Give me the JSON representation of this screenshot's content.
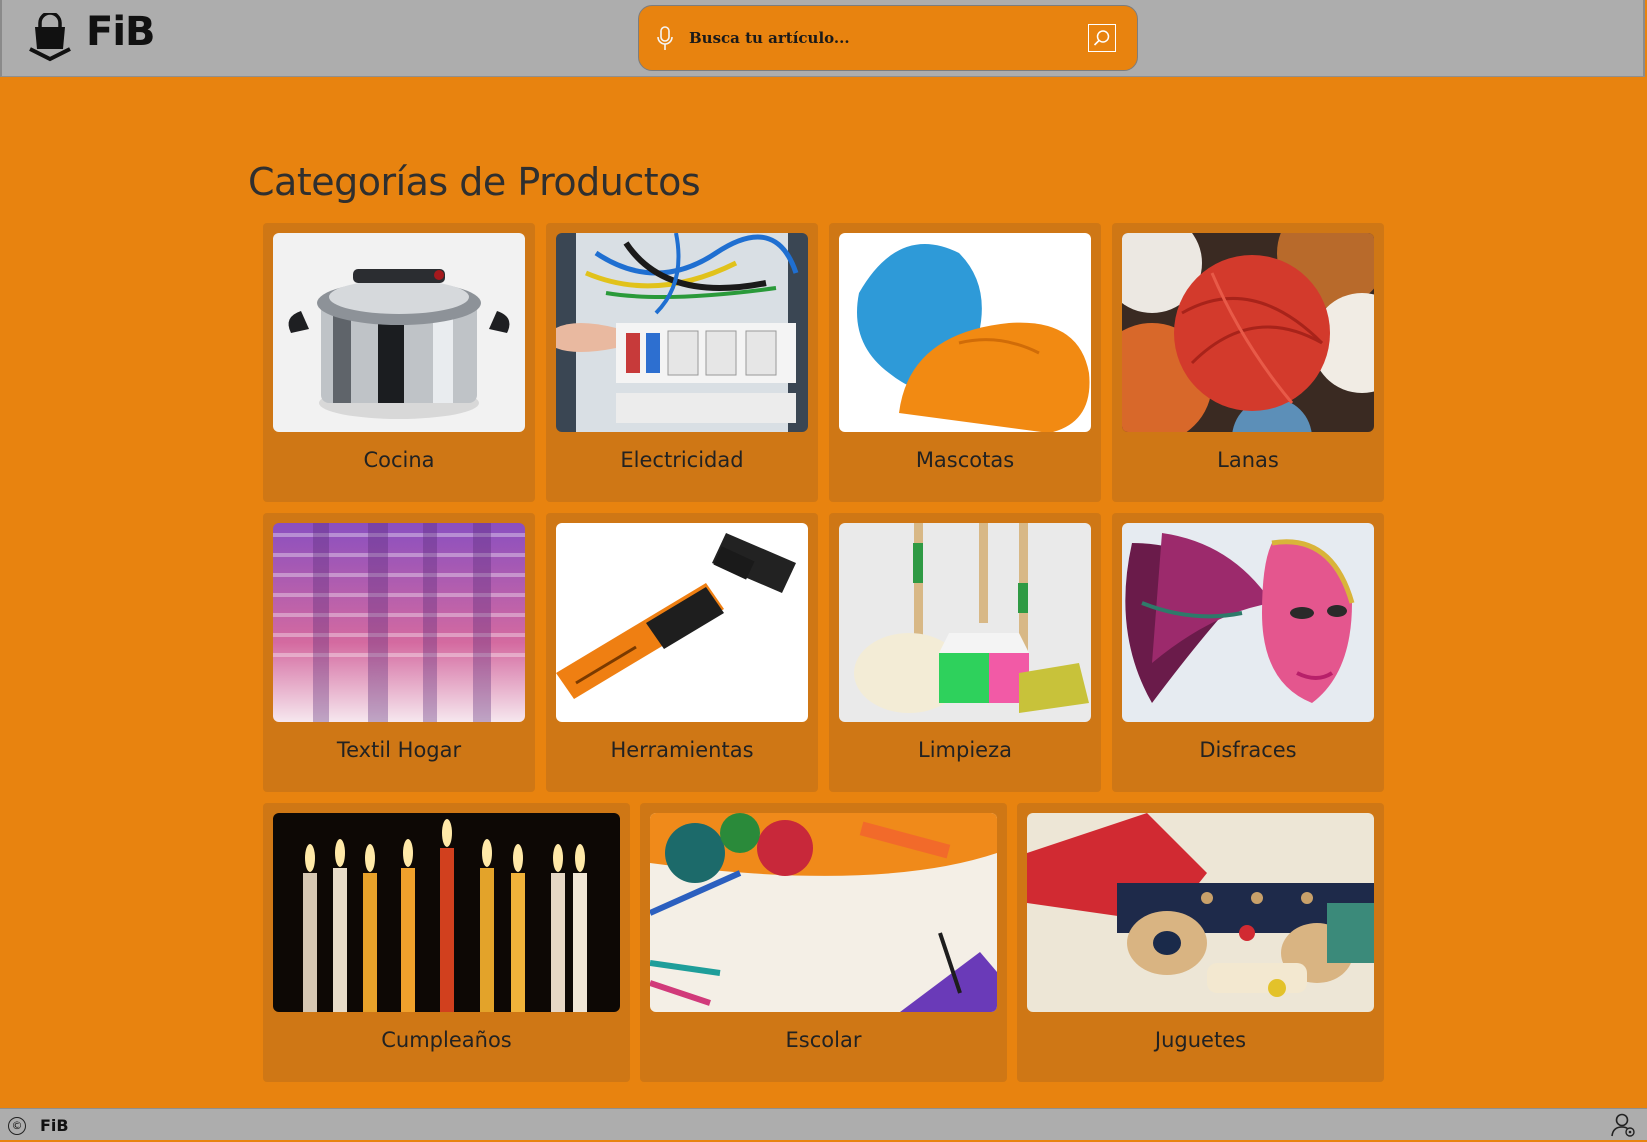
{
  "header": {
    "brand": "FiB",
    "search": {
      "placeholder": "Busca tu artículo..."
    }
  },
  "main": {
    "title": "Categorías de Productos",
    "categories": [
      {
        "label": "Cocina",
        "icon": "pressure-cooker-image"
      },
      {
        "label": "Electricidad",
        "icon": "electrical-panel-image"
      },
      {
        "label": "Mascotas",
        "icon": "pet-toys-image"
      },
      {
        "label": "Lanas",
        "icon": "yarn-balls-image"
      },
      {
        "label": "Textil Hogar",
        "icon": "curtain-image"
      },
      {
        "label": "Herramientas",
        "icon": "hammer-image"
      },
      {
        "label": "Limpieza",
        "icon": "mop-broom-image"
      },
      {
        "label": "Disfraces",
        "icon": "carnival-mask-image"
      },
      {
        "label": "Cumpleaños",
        "icon": "candles-image"
      },
      {
        "label": "Escolar",
        "icon": "school-supplies-image"
      },
      {
        "label": "Juguetes",
        "icon": "wooden-toys-image"
      }
    ]
  },
  "footer": {
    "copyright_symbol": "©",
    "brand": "FiB"
  },
  "colors": {
    "page_background": "#e8830f",
    "card_background": "#cf7715",
    "header_background": "#adadad"
  }
}
